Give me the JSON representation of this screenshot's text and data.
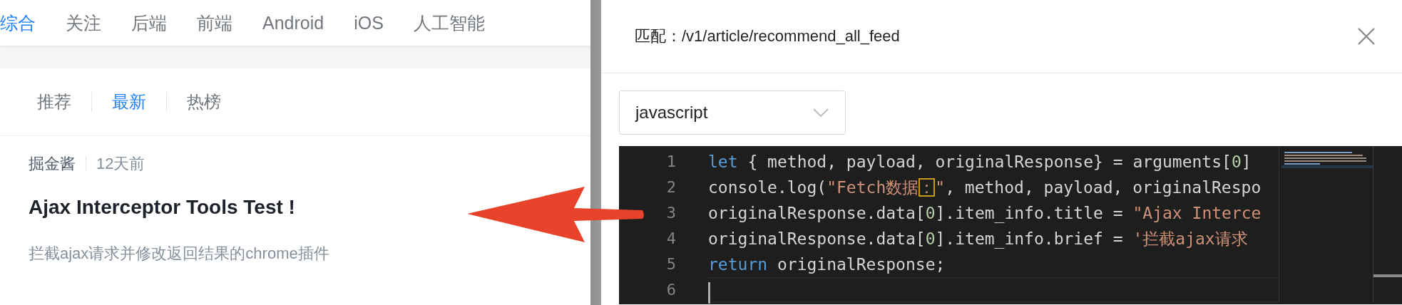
{
  "nav_tabs": [
    {
      "label": "综合",
      "selected": true
    },
    {
      "label": "关注",
      "selected": false
    },
    {
      "label": "后端",
      "selected": false
    },
    {
      "label": "前端",
      "selected": false
    },
    {
      "label": "Android",
      "selected": false
    },
    {
      "label": "iOS",
      "selected": false
    },
    {
      "label": "人工智能",
      "selected": false
    }
  ],
  "sub_tabs": [
    {
      "label": "推荐",
      "selected": false
    },
    {
      "label": "最新",
      "selected": true
    },
    {
      "label": "热榜",
      "selected": false
    }
  ],
  "article": {
    "author": "掘金酱",
    "time": "12天前",
    "title": "Ajax Interceptor Tools Test !",
    "brief": "拦截ajax请求并修改返回结果的chrome插件"
  },
  "drawer": {
    "title": "匹配：/v1/article/recommend_all_feed",
    "language_select": {
      "value": "javascript"
    },
    "editor": {
      "lines": [
        {
          "number": "1",
          "current": false,
          "tokens": [
            {
              "kind": "keyword",
              "text": "let"
            },
            {
              "kind": "plain",
              "text": " { method, payload, originalResponse} = arguments["
            },
            {
              "kind": "number",
              "text": "0"
            },
            {
              "kind": "plain",
              "text": "]"
            }
          ]
        },
        {
          "number": "2",
          "current": false,
          "tokens": [
            {
              "kind": "plain",
              "text": "console.log("
            },
            {
              "kind": "string",
              "text": "\"Fetch数据"
            },
            {
              "kind": "match",
              "text": "："
            },
            {
              "kind": "string",
              "text": "\""
            },
            {
              "kind": "plain",
              "text": ", method, payload, originalRespo"
            }
          ]
        },
        {
          "number": "3",
          "current": false,
          "tokens": [
            {
              "kind": "plain",
              "text": "originalResponse.data["
            },
            {
              "kind": "number",
              "text": "0"
            },
            {
              "kind": "plain",
              "text": "].item_info.title = "
            },
            {
              "kind": "string",
              "text": "\"Ajax Interce"
            }
          ]
        },
        {
          "number": "4",
          "current": false,
          "tokens": [
            {
              "kind": "plain",
              "text": "originalResponse.data["
            },
            {
              "kind": "number",
              "text": "0"
            },
            {
              "kind": "plain",
              "text": "].item_info.brief = "
            },
            {
              "kind": "string",
              "text": "'拦截ajax请求"
            }
          ]
        },
        {
          "number": "5",
          "current": false,
          "tokens": [
            {
              "kind": "keyword",
              "text": "return"
            },
            {
              "kind": "plain",
              "text": " originalResponse;"
            }
          ]
        },
        {
          "number": "6",
          "current": true
        }
      ]
    }
  }
}
